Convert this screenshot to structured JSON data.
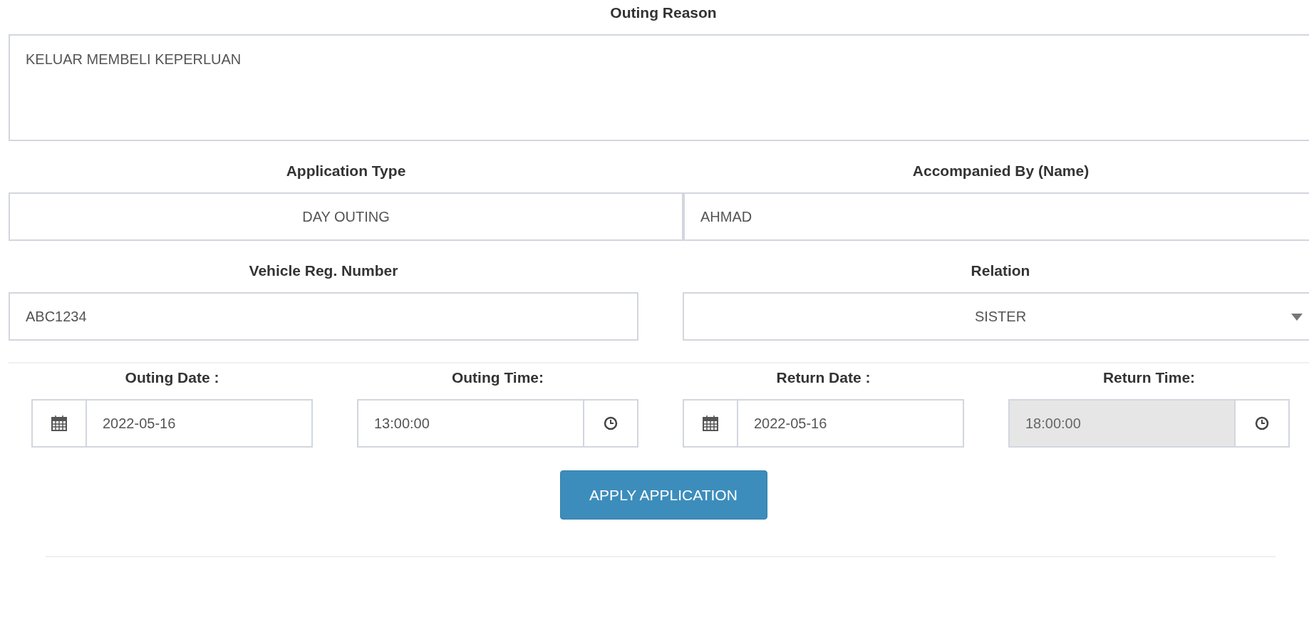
{
  "outing_reason": {
    "label": "Outing Reason",
    "value": "KELUAR MEMBELI KEPERLUAN"
  },
  "application_type": {
    "label": "Application Type",
    "value": "DAY OUTING"
  },
  "accompanied_by": {
    "label": "Accompanied By (Name)",
    "value": "AHMAD"
  },
  "vehicle_reg": {
    "label": "Vehicle Reg. Number",
    "value": "ABC1234"
  },
  "relation": {
    "label": "Relation",
    "value": "SISTER"
  },
  "schedule": [
    {
      "kind": "date",
      "label": "Outing Date :",
      "value": "2022-05-16",
      "disabled": false
    },
    {
      "kind": "time",
      "label": "Outing Time:",
      "value": "13:00:00",
      "disabled": false
    },
    {
      "kind": "date",
      "label": "Return Date :",
      "value": "2022-05-16",
      "disabled": false
    },
    {
      "kind": "time",
      "label": "Return Time:",
      "value": "18:00:00",
      "disabled": true
    }
  ],
  "submit_button": "APPLY APPLICATION"
}
